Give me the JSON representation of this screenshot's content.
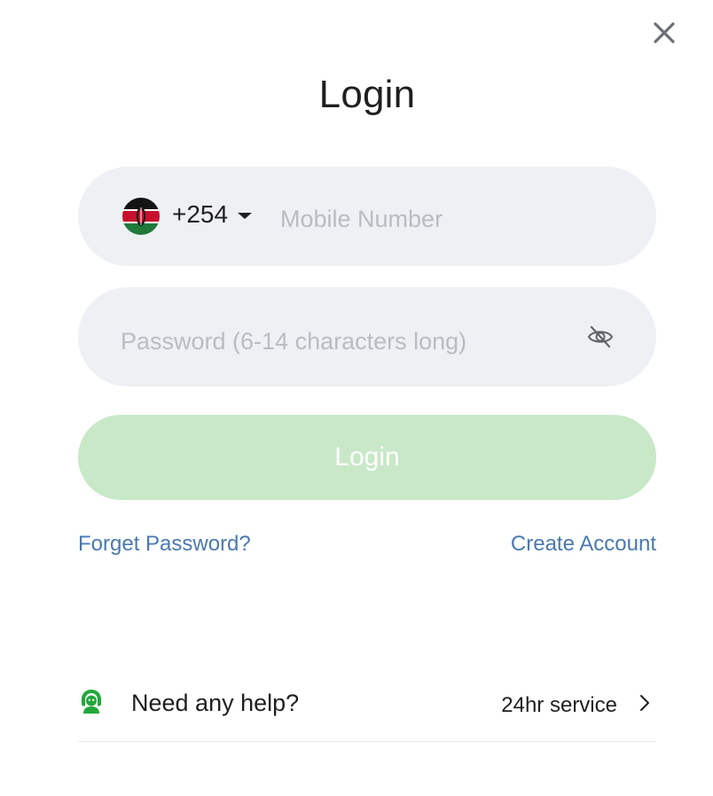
{
  "dialog": {
    "title": "Login",
    "close_icon": "close-icon"
  },
  "phone": {
    "flag_icon": "kenya-flag-icon",
    "country_code": "+254",
    "value": "",
    "placeholder": "Mobile Number"
  },
  "password": {
    "value": "",
    "placeholder": "Password (6-14 characters long)",
    "toggle_icon": "eye-slash-icon"
  },
  "login_button": {
    "label": "Login",
    "color": "#c8e8c7"
  },
  "links": {
    "forget_password": "Forget Password?",
    "create_account": "Create Account",
    "color": "#4a79b0"
  },
  "help": {
    "icon": "support-agent-icon",
    "label": "Need any help?",
    "service": "24hr service",
    "color": "#22a83a"
  }
}
